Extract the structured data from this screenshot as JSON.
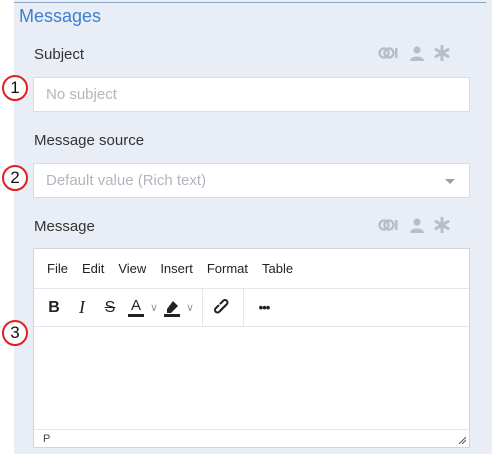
{
  "section": {
    "title": "Messages"
  },
  "subject": {
    "label": "Subject",
    "placeholder": "No subject",
    "badge": "1"
  },
  "source": {
    "label": "Message source",
    "placeholder": "Default value (Rich text)",
    "badge": "2"
  },
  "message": {
    "label": "Message",
    "badge": "3",
    "menu": [
      "File",
      "Edit",
      "View",
      "Insert",
      "Format",
      "Table"
    ],
    "toolbar": {
      "bold": "B",
      "italic": "I",
      "strike": "S",
      "text_color": "A",
      "more": "•••"
    },
    "status_path": "P"
  },
  "icons": [
    "link-variable-icon",
    "user-icon",
    "asterisk-icon"
  ],
  "colors": {
    "accent": "#3b7fd1",
    "panel": "#e9eef6",
    "badge_border": "#e02020"
  }
}
